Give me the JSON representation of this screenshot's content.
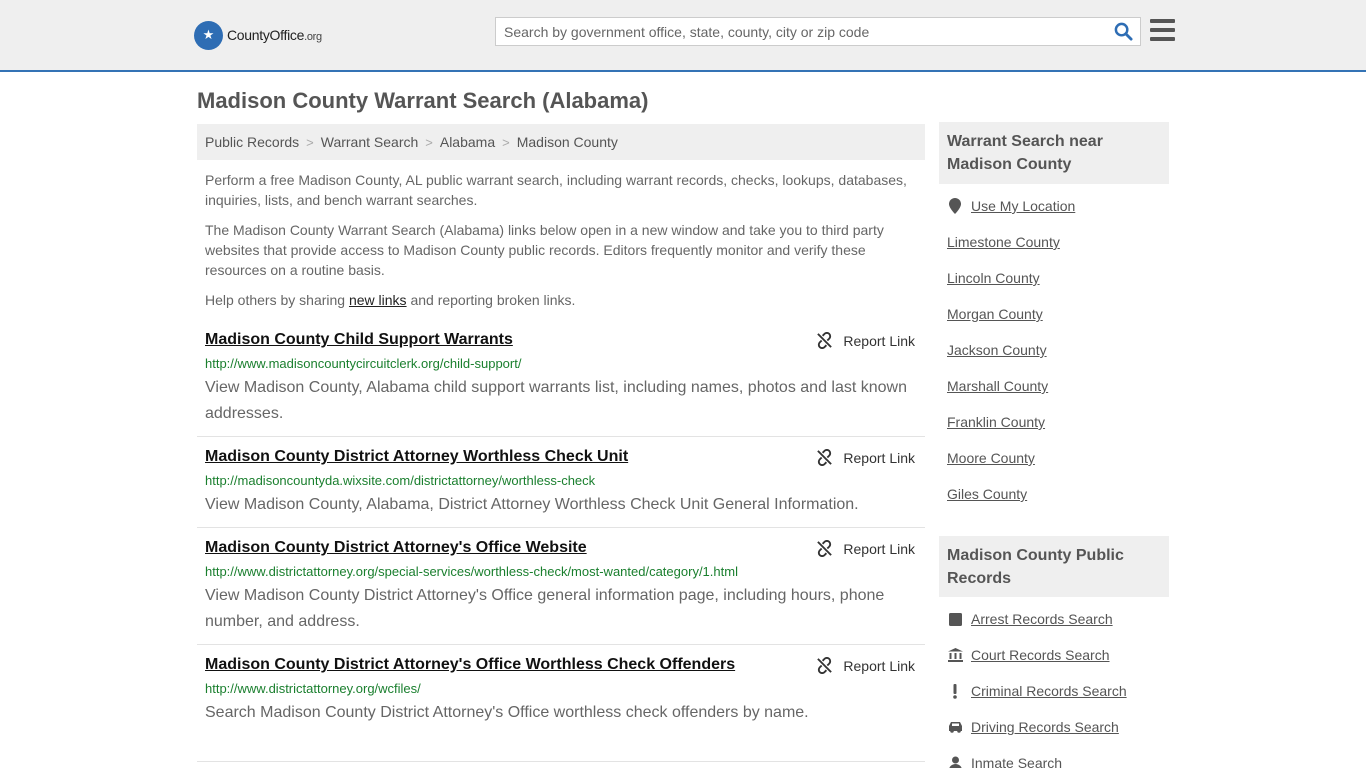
{
  "header": {
    "logo_main": "CountyOffice",
    "logo_tld": ".org",
    "search_placeholder": "Search by government office, state, county, city or zip code"
  },
  "page": {
    "title": "Madison County Warrant Search (Alabama)"
  },
  "breadcrumb": [
    "Public Records",
    "Warrant Search",
    "Alabama",
    "Madison County"
  ],
  "intro": {
    "p1": "Perform a free Madison County, AL public warrant search, including warrant records, checks, lookups, databases, inquiries, lists, and bench warrant searches.",
    "p2": "The Madison County Warrant Search (Alabama) links below open in a new window and take you to third party websites that provide access to Madison County public records. Editors frequently monitor and verify these resources on a routine basis.",
    "p3_before": "Help others by sharing ",
    "p3_link": "new links",
    "p3_after": " and reporting broken links."
  },
  "report_label": "Report Link",
  "results": [
    {
      "title": "Madison County Child Support Warrants",
      "url": "http://www.madisoncountycircuitclerk.org/child-support/",
      "desc": "View Madison County, Alabama child support warrants list, including names, photos and last known addresses."
    },
    {
      "title": "Madison County District Attorney Worthless Check Unit",
      "url": "http://madisoncountyda.wixsite.com/districtattorney/worthless-check",
      "desc": "View Madison County, Alabama, District Attorney Worthless Check Unit General Information."
    },
    {
      "title": "Madison County District Attorney's Office Website",
      "url": "http://www.districtattorney.org/special-services/worthless-check/most-wanted/category/1.html",
      "desc": "View Madison County District Attorney's Office general information page, including hours, phone number, and address."
    },
    {
      "title": "Madison County District Attorney's Office Worthless Check Offenders",
      "url": "http://www.districtattorney.org/wcfiles/",
      "desc": "Search Madison County District Attorney's Office worthless check offenders by name."
    }
  ],
  "sidebar": {
    "nearby_title": "Warrant Search near Madison County",
    "use_location": "Use My Location",
    "nearby": [
      "Limestone County",
      "Lincoln County",
      "Morgan County",
      "Jackson County",
      "Marshall County",
      "Franklin County",
      "Moore County",
      "Giles County"
    ],
    "records_title": "Madison County Public Records",
    "records": [
      {
        "label": "Arrest Records Search",
        "icon": "square-icon"
      },
      {
        "label": "Court Records Search",
        "icon": "courthouse-icon"
      },
      {
        "label": "Criminal Records Search",
        "icon": "exclamation-icon"
      },
      {
        "label": "Driving Records Search",
        "icon": "car-icon"
      },
      {
        "label": "Inmate Search",
        "icon": "person-icon"
      }
    ]
  }
}
